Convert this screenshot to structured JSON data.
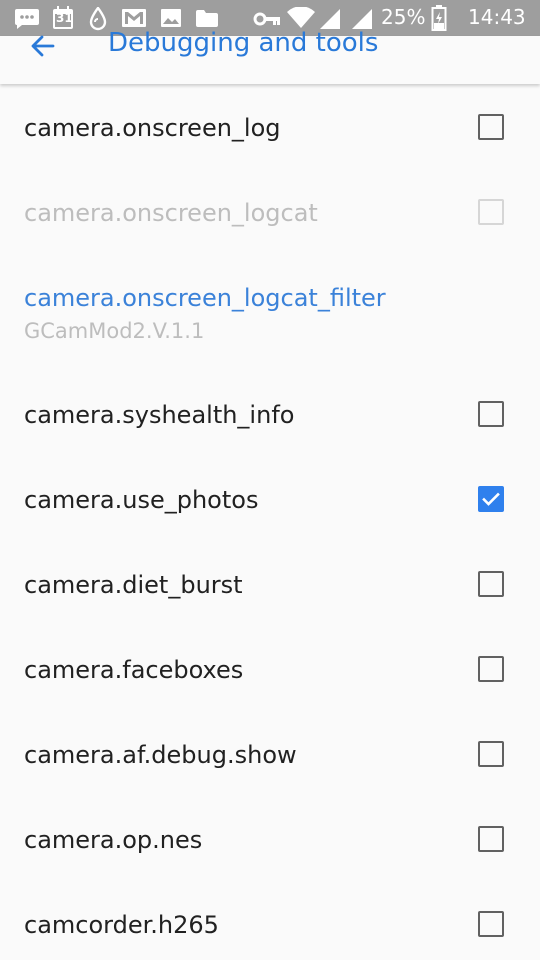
{
  "status_bar": {
    "calendar_day": "31",
    "battery_percent": "25%",
    "time": "14:43",
    "icons": [
      "chat-icon",
      "calendar-icon",
      "drop-icon",
      "gmail-icon",
      "image-icon",
      "folder-icon",
      "key-icon",
      "wifi-icon",
      "signal-icon",
      "signal-icon-2",
      "battery-icon"
    ]
  },
  "app_bar": {
    "title": "Debugging and tools",
    "back_icon": "arrow-back-icon"
  },
  "colors": {
    "accent": "#2979d8",
    "checkbox_checked": "#2f80ed",
    "status_bar": "#9e9e9e"
  },
  "list": {
    "items": [
      {
        "label": "camera.onscreen_log",
        "checked": false,
        "enabled": true
      },
      {
        "label": "camera.onscreen_logcat",
        "checked": false,
        "enabled": false
      },
      {
        "label": "camera.onscreen_logcat_filter",
        "summary": "GCamMod2.V.1.1"
      },
      {
        "label": "camera.syshealth_info",
        "checked": false,
        "enabled": true
      },
      {
        "label": "camera.use_photos",
        "checked": true,
        "enabled": true
      },
      {
        "label": "camera.diet_burst",
        "checked": false,
        "enabled": true
      },
      {
        "label": "camera.faceboxes",
        "checked": false,
        "enabled": true
      },
      {
        "label": "camera.af.debug.show",
        "checked": false,
        "enabled": true
      },
      {
        "label": "camera.op.nes",
        "checked": false,
        "enabled": true
      },
      {
        "label": "camcorder.h265",
        "checked": false,
        "enabled": true
      }
    ]
  }
}
